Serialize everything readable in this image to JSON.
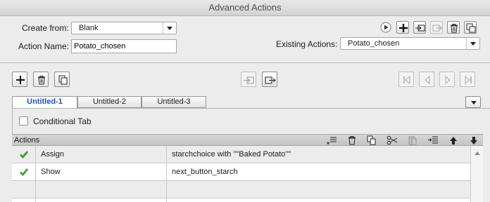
{
  "window": {
    "title": "Advanced Actions"
  },
  "form": {
    "create_from_label": "Create from:",
    "create_from_value": "Blank",
    "action_name_label": "Action Name:",
    "action_name_value": "Potato_chosen",
    "existing_actions_label": "Existing Actions:",
    "existing_actions_value": "Potato_chosen"
  },
  "tabs": [
    {
      "label": "Untitled-1",
      "active": true
    },
    {
      "label": "Untitled-2",
      "active": false
    },
    {
      "label": "Untitled-3",
      "active": false
    }
  ],
  "conditional_tab": {
    "label": "Conditional Tab",
    "checked": false
  },
  "actions_table": {
    "header": "Actions",
    "rows": [
      {
        "status": "check",
        "action": "Assign",
        "detail": "starchchoice   with   \"\"Baked Potato\"\""
      },
      {
        "status": "check",
        "action": "Show",
        "detail": "next_button_starch"
      },
      {
        "status": "",
        "action": "",
        "detail": ""
      }
    ]
  },
  "colors": {
    "active_tab_text": "#1c4fd1",
    "check_green": "#3a9a2a",
    "background": "#ececec"
  },
  "icons": {
    "top_toolbar": [
      "play-icon",
      "add-icon",
      "import-icon",
      "export-icon",
      "delete-icon",
      "duplicate-icon"
    ],
    "tab_toolbar": [
      "add-icon",
      "delete-icon",
      "duplicate-icon",
      "import-icon",
      "export-icon",
      "first-icon",
      "prev-icon",
      "next-icon",
      "last-icon"
    ],
    "grid_toolbar": [
      "insert-icon",
      "delete-icon",
      "copy-icon",
      "cut-icon",
      "paste-icon",
      "insert-below-icon",
      "move-up-icon",
      "move-down-icon"
    ]
  }
}
